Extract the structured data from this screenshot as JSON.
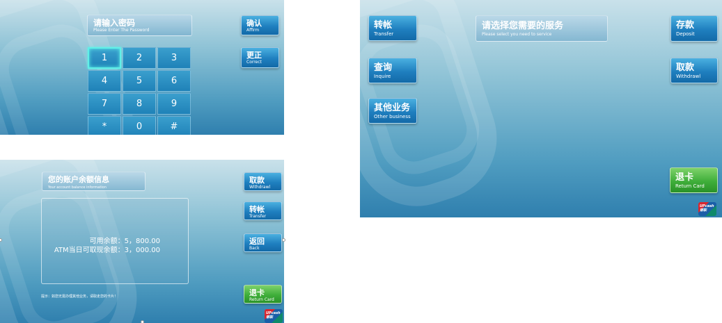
{
  "password_screen": {
    "title_cn": "请输入密码",
    "title_en": "Please Enter The Password",
    "keys": [
      "1",
      "2",
      "3",
      "4",
      "5",
      "6",
      "7",
      "8",
      "9",
      "*",
      "0",
      "#"
    ],
    "affirm": {
      "cn": "确认",
      "en": "Affirm"
    },
    "correct": {
      "cn": "更正",
      "en": "Correct"
    }
  },
  "service_screen": {
    "title_cn": "请选择您需要的服务",
    "title_en": "Please select you need to service",
    "transfer": {
      "cn": "转帐",
      "en": "Transfer"
    },
    "inquire": {
      "cn": "查询",
      "en": "Inquire"
    },
    "other": {
      "cn": "其他业务",
      "en": "Other business"
    },
    "deposit": {
      "cn": "存款",
      "en": "Deposit"
    },
    "withdrawl": {
      "cn": "取款",
      "en": "Withdrawl"
    },
    "return_card": {
      "cn": "退卡",
      "en": "Return Card"
    },
    "logo_text": "UPcash 银联"
  },
  "balance_screen": {
    "title_cn": "您的账户余额信息",
    "title_en": "Your account balance information",
    "available_label": "可用余额：",
    "available_value": "5，800.00",
    "atm_label": "ATM当日可取现余额：",
    "atm_value": "3，000.00",
    "withdrawl": {
      "cn": "取款",
      "en": "Withdrawl"
    },
    "transfer": {
      "cn": "转帐",
      "en": "Transfer"
    },
    "back": {
      "cn": "返回",
      "en": "Back"
    },
    "return_card": {
      "cn": "退卡",
      "en": "Return Card"
    },
    "tip": "提示：如您无需办理其他业务，请取走您的卡片！",
    "logo_text": "UPcash 银联"
  },
  "colors": {
    "button_blue": "#1f7fbf",
    "button_green": "#3fae3a",
    "key_highlight": "#5ff0e8",
    "background_blue": "#4f9cc0"
  }
}
